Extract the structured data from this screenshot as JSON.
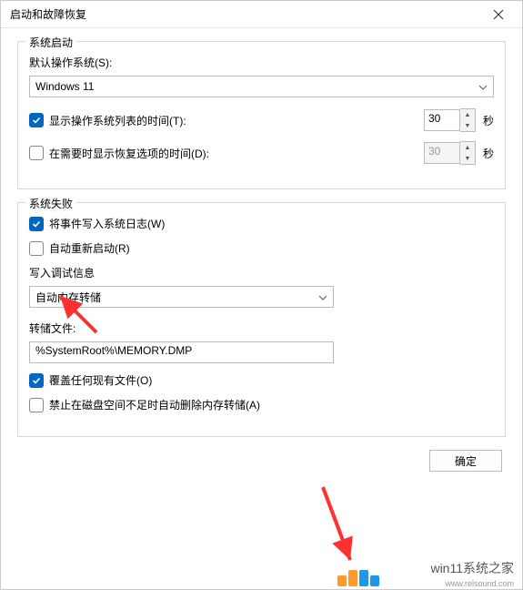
{
  "titlebar": {
    "title": "启动和故障恢复"
  },
  "startup": {
    "group_title": "系统启动",
    "default_os_label": "默认操作系统(S):",
    "default_os_value": "Windows 11",
    "show_os_list_label": "显示操作系统列表的时间(T):",
    "show_os_list_checked": true,
    "show_os_list_time": "30",
    "show_recovery_label": "在需要时显示恢复选项的时间(D):",
    "show_recovery_checked": false,
    "show_recovery_time": "30",
    "seconds_label": "秒"
  },
  "failure": {
    "group_title": "系统失败",
    "write_log_label": "将事件写入系统日志(W)",
    "write_log_checked": true,
    "auto_restart_label": "自动重新启动(R)",
    "auto_restart_checked": false,
    "debug_info_label": "写入调试信息",
    "debug_select_value": "自动内存转储",
    "dump_file_label": "转储文件:",
    "dump_file_value": "%SystemRoot%\\MEMORY.DMP",
    "overwrite_label": "覆盖任何现有文件(O)",
    "overwrite_checked": true,
    "no_delete_label": "禁止在磁盘空间不足时自动删除内存转储(A)",
    "no_delete_checked": false
  },
  "buttons": {
    "ok": "确定"
  },
  "watermark": {
    "text": "win11系统之家",
    "sub": "www.relsound.com"
  },
  "colors": {
    "accent": "#0067c0",
    "arrow": "#ff3030",
    "logo_orange": "#ff9a2e",
    "logo_blue": "#1f97e8"
  }
}
